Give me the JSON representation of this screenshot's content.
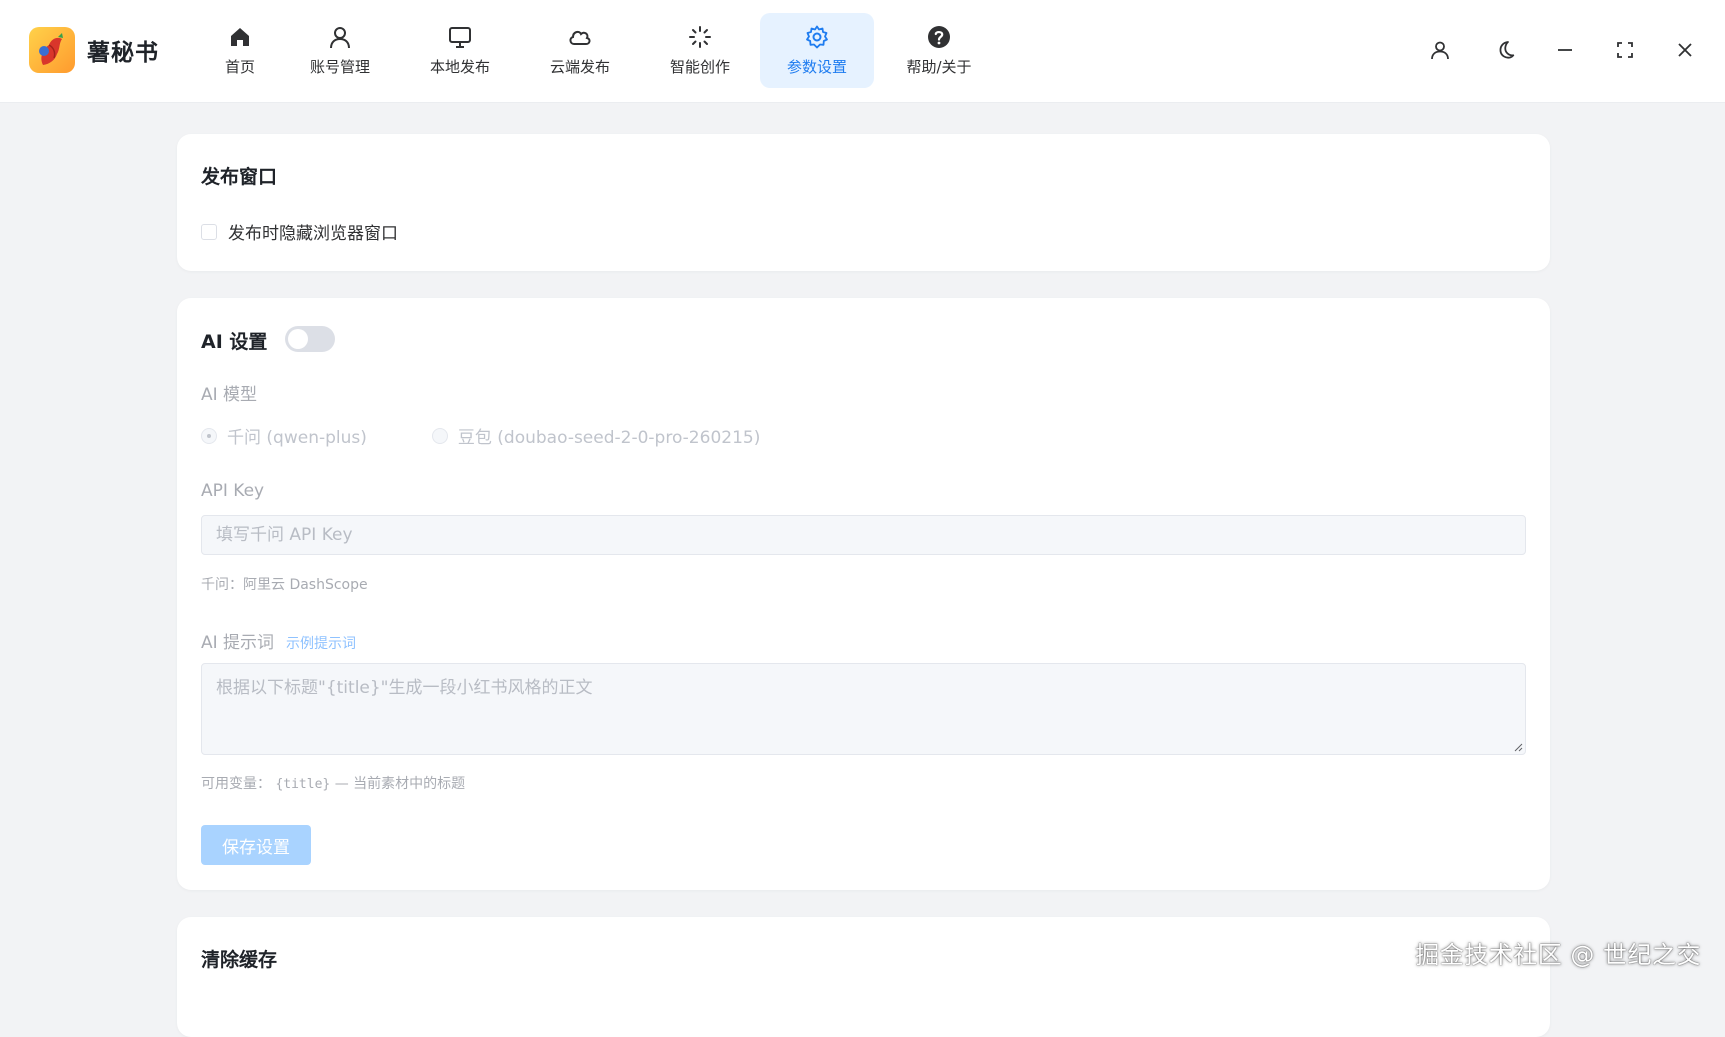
{
  "app": {
    "name": "薯秘书"
  },
  "nav": [
    {
      "label": "首页",
      "icon": "home-icon"
    },
    {
      "label": "账号管理",
      "icon": "user-icon"
    },
    {
      "label": "本地发布",
      "icon": "monitor-icon"
    },
    {
      "label": "云端发布",
      "icon": "cloud-icon"
    },
    {
      "label": "智能创作",
      "icon": "sparkle-icon"
    },
    {
      "label": "参数设置",
      "icon": "gear-icon",
      "active": true
    },
    {
      "label": "帮助/关于",
      "icon": "help-icon"
    }
  ],
  "window_controls": [
    "user-icon",
    "moon-icon",
    "minimize-icon",
    "fullscreen-icon",
    "close-icon"
  ],
  "publish_window": {
    "title": "发布窗口",
    "hide_browser_label": "发布时隐藏浏览器窗口",
    "hide_browser_checked": false
  },
  "ai_settings": {
    "title": "AI 设置",
    "enabled": false,
    "model_label": "AI 模型",
    "models": [
      {
        "label": "千问 (qwen-plus)",
        "selected": true
      },
      {
        "label": "豆包 (doubao-seed-2-0-pro-260215)",
        "selected": false
      }
    ],
    "api_key_label": "API Key",
    "api_key_placeholder": "填写千问 API Key",
    "api_key_hint": "千问：阿里云 DashScope",
    "prompt_label": "AI 提示词",
    "prompt_example_link": "示例提示词",
    "prompt_placeholder": "根据以下标题\"{title}\"生成一段小红书风格的正文",
    "variables_hint_prefix": "可用变量：",
    "variables_hint_var": "{title}",
    "variables_hint_suffix": "— 当前素材中的标题",
    "save_button": "保存设置"
  },
  "clear_cache": {
    "title": "清除缓存"
  },
  "watermark": "掘金技术社区 @ 世纪之交",
  "colors": {
    "accent": "#1e7cf0",
    "active_bg": "#e6f2ff",
    "save_disabled": "#a9d3ff",
    "page_bg": "#f2f3f5"
  }
}
